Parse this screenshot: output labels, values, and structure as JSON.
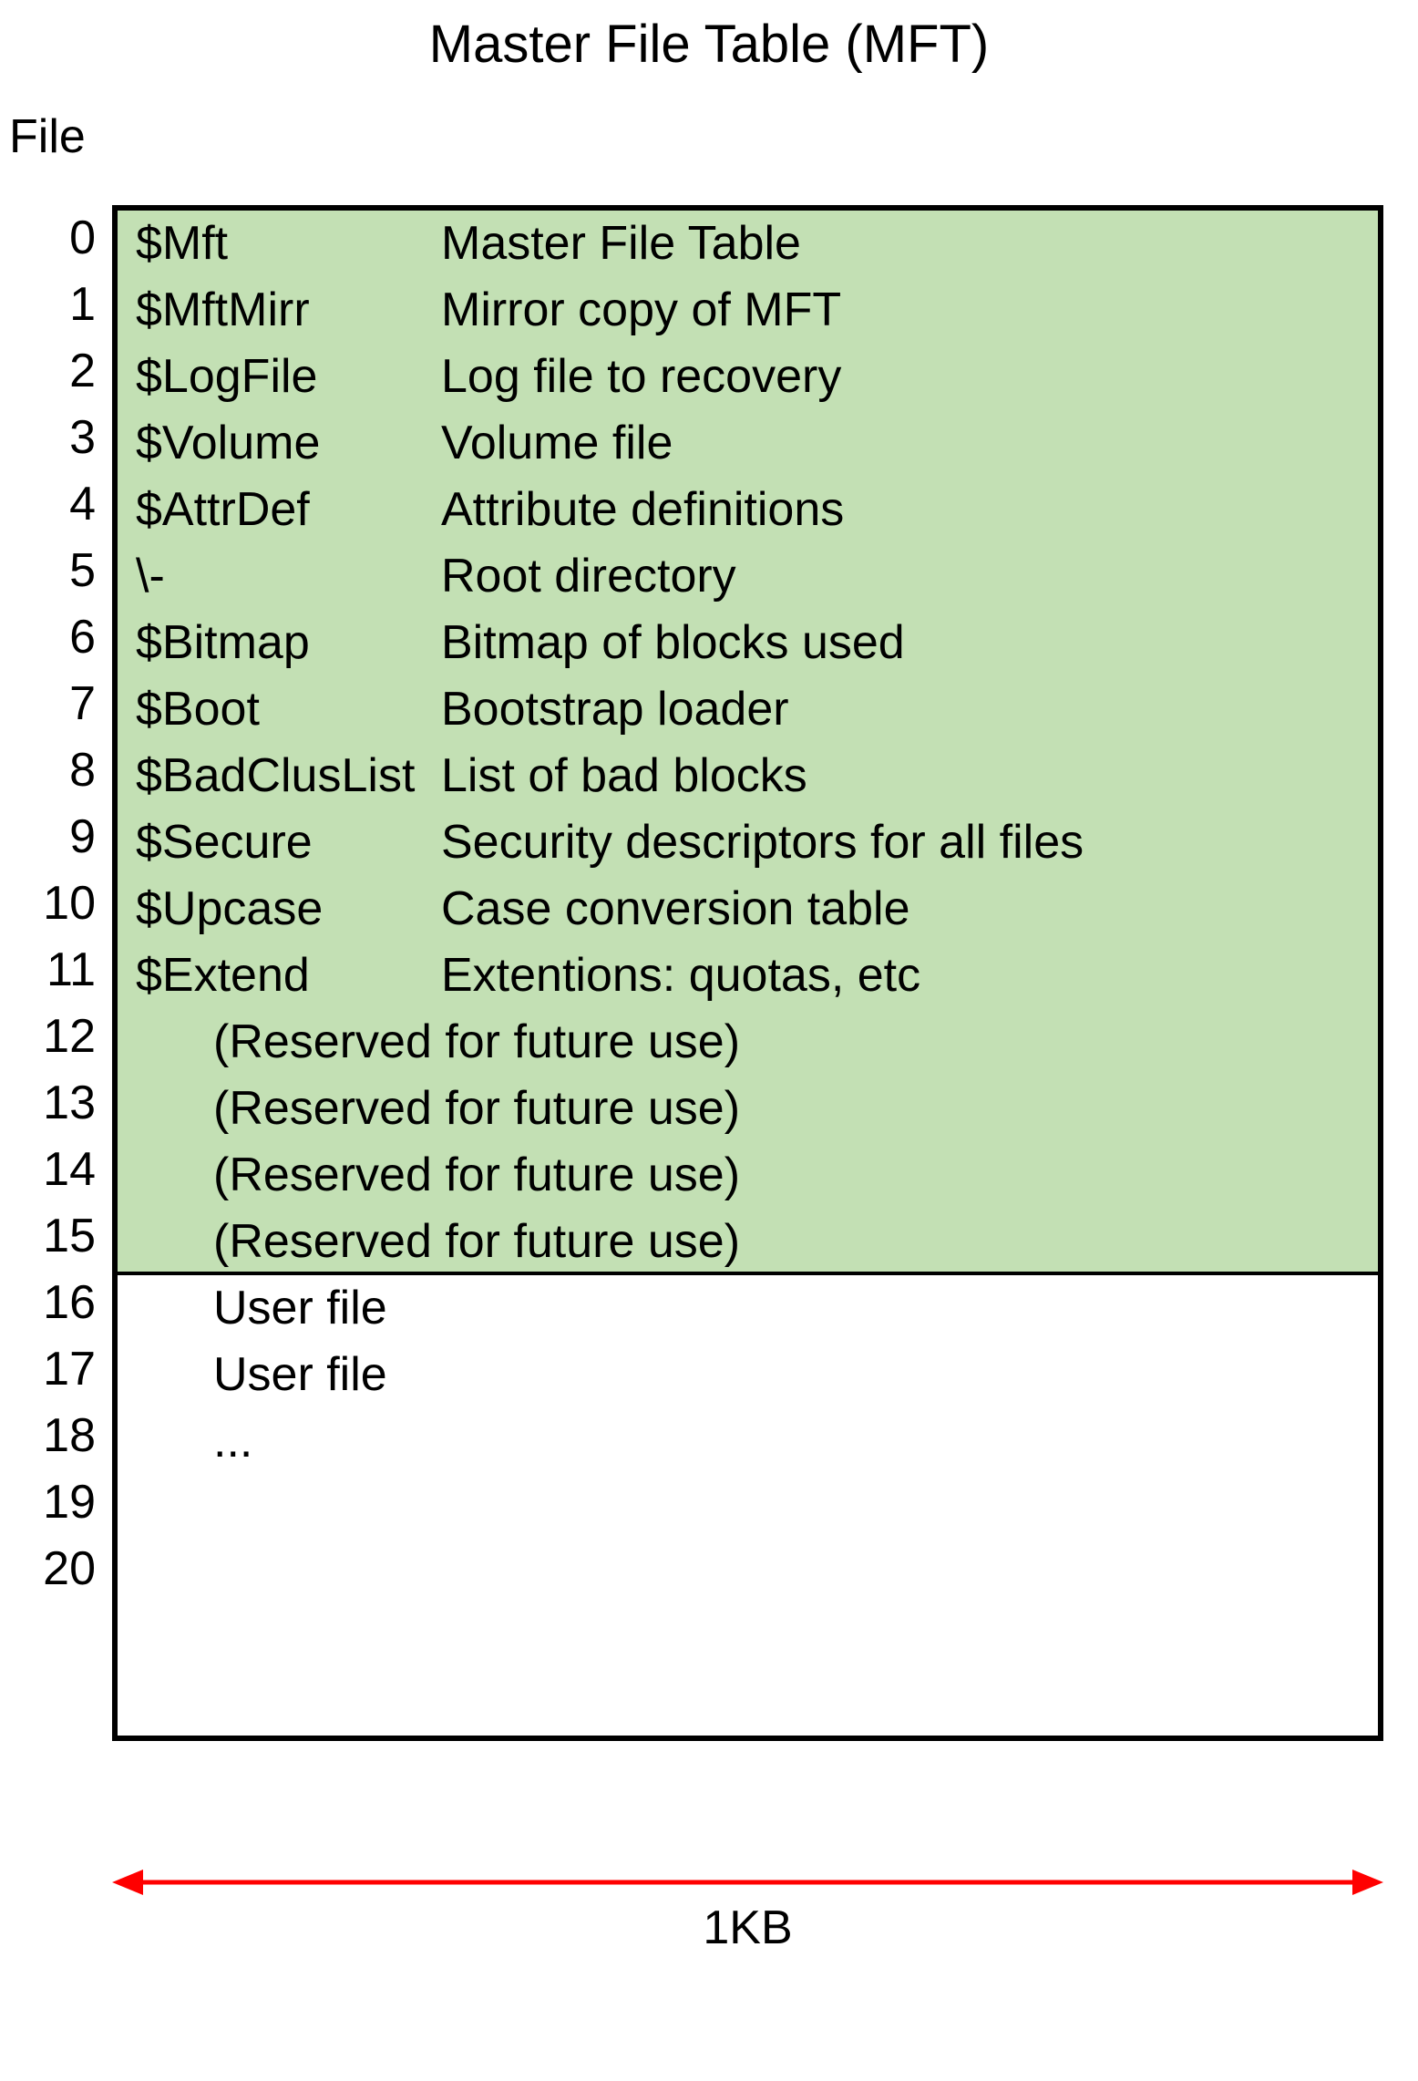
{
  "title": "Master File Table (MFT)",
  "column_header": "File",
  "size_label": "1KB",
  "colors": {
    "shade": "#c3e0b4",
    "arrow": "#ff0000"
  },
  "rows": [
    {
      "index": "0",
      "name": "$Mft",
      "desc": "Master File Table",
      "kind": "system"
    },
    {
      "index": "1",
      "name": "$MftMirr",
      "desc": "Mirror copy of MFT",
      "kind": "system"
    },
    {
      "index": "2",
      "name": "$LogFile",
      "desc": "Log file to recovery",
      "kind": "system"
    },
    {
      "index": "3",
      "name": "$Volume",
      "desc": "Volume file",
      "kind": "system"
    },
    {
      "index": "4",
      "name": "$AttrDef",
      "desc": "Attribute definitions",
      "kind": "system"
    },
    {
      "index": "5",
      "name": "\\-",
      "desc": "Root directory",
      "kind": "system"
    },
    {
      "index": "6",
      "name": "$Bitmap",
      "desc": "Bitmap of blocks used",
      "kind": "system"
    },
    {
      "index": "7",
      "name": "$Boot",
      "desc": "Bootstrap loader",
      "kind": "system"
    },
    {
      "index": "8",
      "name": "$BadClusList",
      "desc": "List of bad blocks",
      "kind": "system"
    },
    {
      "index": "9",
      "name": "$Secure",
      "desc": "Security descriptors for all files",
      "kind": "system"
    },
    {
      "index": "10",
      "name": "$Upcase",
      "desc": "Case conversion table",
      "kind": "system"
    },
    {
      "index": "11",
      "name": "$Extend",
      "desc": "Extentions: quotas, etc",
      "kind": "system"
    },
    {
      "index": "12",
      "name": "",
      "desc": "(Reserved for future use)",
      "kind": "reserved"
    },
    {
      "index": "13",
      "name": "",
      "desc": "(Reserved for future use)",
      "kind": "reserved"
    },
    {
      "index": "14",
      "name": "",
      "desc": "(Reserved for future use)",
      "kind": "reserved"
    },
    {
      "index": "15",
      "name": "",
      "desc": "(Reserved for future use)",
      "kind": "reserved"
    },
    {
      "index": "16",
      "name": "",
      "desc": "User file",
      "kind": "user"
    },
    {
      "index": "17",
      "name": "",
      "desc": "User file",
      "kind": "user"
    },
    {
      "index": "18",
      "name": "",
      "desc": "   ...",
      "kind": "user"
    },
    {
      "index": "19",
      "name": "",
      "desc": "",
      "kind": "user"
    },
    {
      "index": "20",
      "name": "",
      "desc": "",
      "kind": "user"
    }
  ]
}
